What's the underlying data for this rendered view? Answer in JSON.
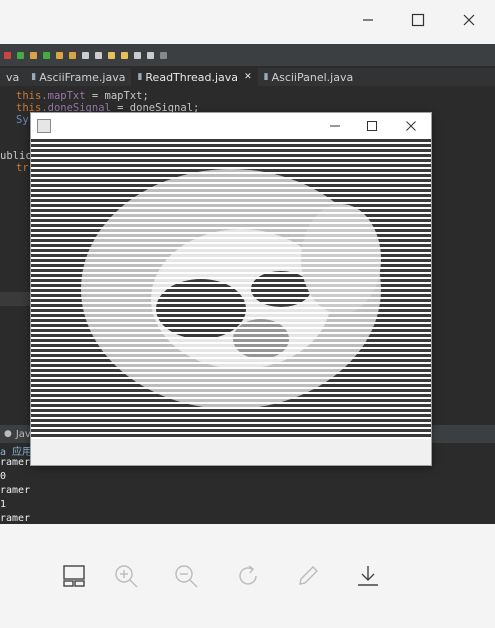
{
  "window_controls": [
    "minimize",
    "maximize",
    "close"
  ],
  "editor": {
    "tabs": [
      {
        "label": "va",
        "icon": "none",
        "active": false,
        "closable": false
      },
      {
        "label": "AsciiFrame.java",
        "icon": "java-file-icon",
        "active": false,
        "closable": false
      },
      {
        "label": "ReadThread.java",
        "icon": "java-file-icon",
        "active": true,
        "closable": true
      },
      {
        "label": "AsciiPanel.java",
        "icon": "java-file-icon",
        "active": false,
        "closable": false
      }
    ],
    "code_lines": {
      "l1_kw": "this",
      "l1_field": ".mapTxt",
      "l1_rest": " = mapTxt;",
      "l2_kw": "this",
      "l2_field": ".doneSignal",
      "l2_rest": " = doneSignal;",
      "l3": "Sy",
      "l4": "ublic",
      "l5": "tr"
    }
  },
  "console": {
    "tab_label": "Java",
    "header_label": "a 应用",
    "lines": [
      "ramer",
      "0",
      "ramer",
      "1",
      "ramer"
    ]
  },
  "java_window": {
    "controls": [
      "minimize",
      "maximize",
      "close"
    ]
  },
  "viewer_actions": [
    "layout",
    "zoom-in",
    "zoom-out",
    "rotate",
    "edit",
    "download"
  ],
  "colors": {
    "ide_background": "#2b2b2b",
    "keyword": "#cc7832",
    "field": "#9876aa",
    "viewer_background": "#f4f4f4"
  }
}
